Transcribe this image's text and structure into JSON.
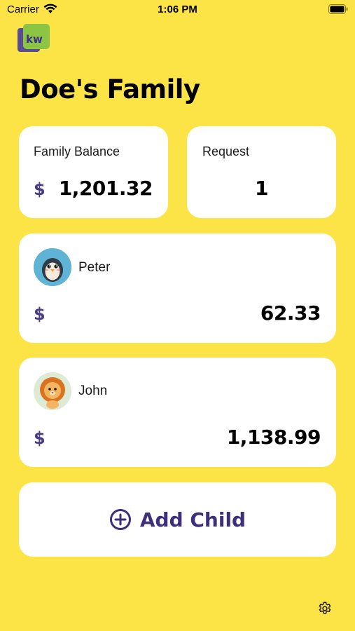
{
  "status_bar": {
    "carrier": "Carrier",
    "time": "1:06 PM"
  },
  "app": {
    "logo_text": "kw"
  },
  "header": {
    "title": "Doe's Family"
  },
  "summary": {
    "balance_label": "Family Balance",
    "balance_currency": "$",
    "balance_value": "1,201.32",
    "request_label": "Request",
    "request_value": "1"
  },
  "children": [
    {
      "name": "Peter",
      "currency": "$",
      "balance": "62.33",
      "avatar_icon": "penguin-avatar"
    },
    {
      "name": "John",
      "currency": "$",
      "balance": "1,138.99",
      "avatar_icon": "lion-avatar"
    }
  ],
  "actions": {
    "add_child_label": "Add Child"
  },
  "footer": {
    "settings_icon": "gear-icon"
  },
  "colors": {
    "background": "#FCE447",
    "card": "#FFFFFF",
    "accent_purple": "#4A3A8A",
    "logo_green": "#8BC543"
  }
}
